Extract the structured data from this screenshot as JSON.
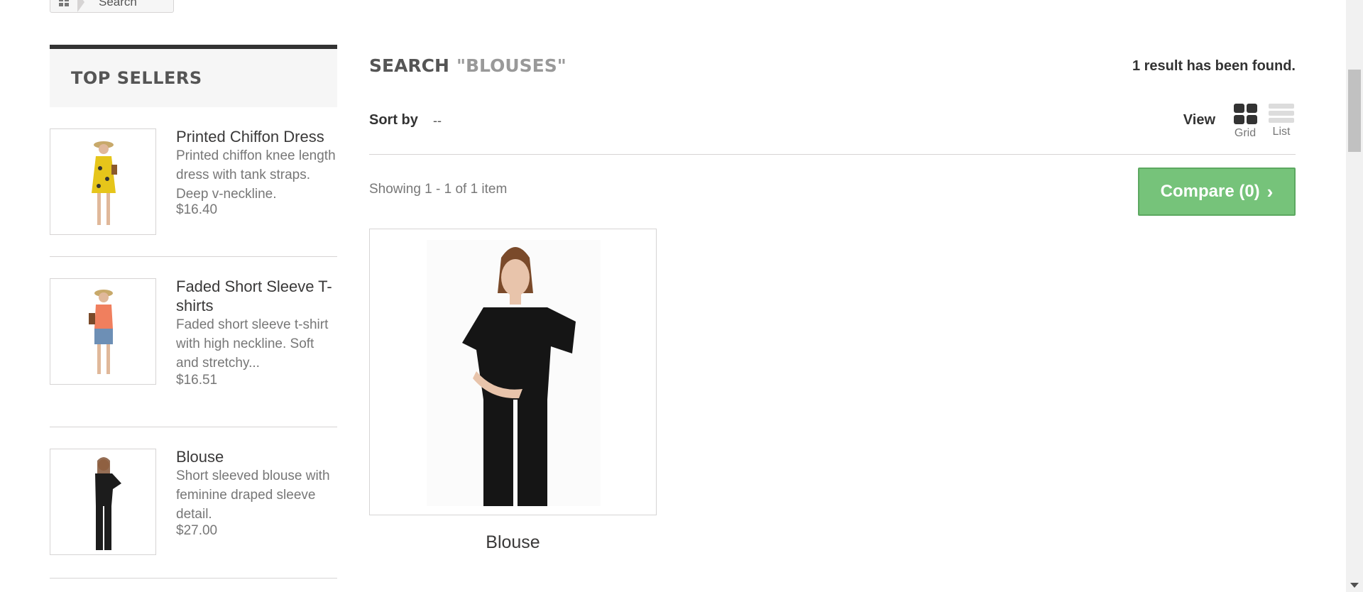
{
  "breadcrumb": {
    "home_icon": "home-icon",
    "current": "Search"
  },
  "sidebar": {
    "title": "TOP SELLERS",
    "items": [
      {
        "name": "Printed Chiffon Dress",
        "description": "Printed chiffon knee length dress with tank straps. Deep v-neckline.",
        "price": "$16.40"
      },
      {
        "name": "Faded Short Sleeve T-shirts",
        "description": "Faded short sleeve t-shirt with high neckline. Soft and stretchy...",
        "price": "$16.51"
      },
      {
        "name": "Blouse",
        "description": "Short sleeved blouse with feminine draped sleeve detail.",
        "price": "$27.00"
      }
    ]
  },
  "main": {
    "heading": "SEARCH",
    "query": "\"BLOUSES\"",
    "result_count": "1 result has been found.",
    "sort_label": "Sort by",
    "sort_value": "--",
    "view_label": "View",
    "view_grid": "Grid",
    "view_list": "List",
    "showing": "Showing 1 - 1 of 1 item",
    "compare_label": "Compare (0)",
    "products": [
      {
        "name": "Blouse"
      }
    ]
  },
  "colors": {
    "compare_bg": "#76c37a",
    "heading": "#555555",
    "accent_dark": "#333333"
  }
}
